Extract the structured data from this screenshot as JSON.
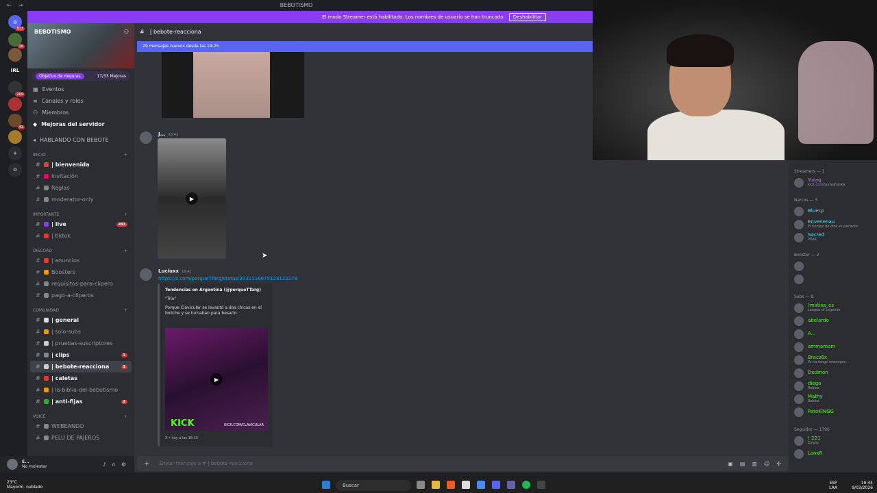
{
  "window": {
    "title": "BEBOTISMO",
    "nav_back": "←",
    "nav_fwd": "→"
  },
  "banner": {
    "text": "El modo Streamer está habilitado. Los nombres de usuario se han truncado.",
    "button": "Deshabilitar"
  },
  "server_rail": {
    "badges": [
      "813",
      "18",
      "209",
      "41"
    ],
    "irl_label": "IRL"
  },
  "sidebar": {
    "server_name": "BEBOTISMO",
    "boost": {
      "label": "Objetivo de mejoras",
      "count": "17/33 Mejoras"
    },
    "menu": [
      "Eventos",
      "Canales y roles",
      "Miembros",
      "Mejoras del servidor"
    ],
    "hablando": "HABLANDO CON BEBOTE",
    "categories": [
      {
        "name": "INICIO",
        "channels": [
          {
            "label": "| bienvenida",
            "bold": true,
            "badge": "",
            "color": "#c44"
          },
          {
            "label": "Invitación",
            "bold": false,
            "badge": "",
            "color": "#e06"
          },
          {
            "label": "Reglas",
            "bold": false,
            "badge": "",
            "color": "#888"
          },
          {
            "label": "moderator-only",
            "bold": false,
            "badge": "",
            "color": "#888"
          }
        ]
      },
      {
        "name": "IMPORTANTE",
        "channels": [
          {
            "label": "| live",
            "bold": true,
            "badge": "203",
            "color": "#8a3cf0"
          },
          {
            "label": "| tiktok",
            "bold": false,
            "badge": "",
            "color": "#e33"
          }
        ]
      },
      {
        "name": "DISCORD",
        "channels": [
          {
            "label": "| anuncios",
            "bold": false,
            "badge": "",
            "color": "#e33"
          },
          {
            "label": "Boosters",
            "bold": false,
            "badge": "",
            "color": "#e90"
          },
          {
            "label": "requisitos-para-clipero",
            "bold": false,
            "badge": "",
            "color": "#888"
          },
          {
            "label": "pago-a-cliperos",
            "bold": false,
            "badge": "",
            "color": "#888"
          }
        ]
      },
      {
        "name": "COMUNIDAD",
        "channels": [
          {
            "label": "| general",
            "bold": true,
            "badge": "",
            "color": "#ddd"
          },
          {
            "label": "| solo-subs",
            "bold": false,
            "badge": "",
            "color": "#e90"
          },
          {
            "label": "| pruebas-suscriptores",
            "bold": false,
            "badge": "",
            "color": "#ccc"
          },
          {
            "label": "| clips",
            "bold": true,
            "badge": "1",
            "color": "#888"
          },
          {
            "label": "| bebote-reacciona",
            "bold": true,
            "badge": "2",
            "color": "#ccc",
            "active": true
          },
          {
            "label": "| caletas",
            "bold": true,
            "badge": "",
            "color": "#e33"
          },
          {
            "label": "| la-biblia-del-bebotismo",
            "bold": false,
            "badge": "",
            "color": "#e90"
          },
          {
            "label": "| anti-fijas",
            "bold": true,
            "badge": "2",
            "color": "#3a3"
          }
        ]
      },
      {
        "name": "VOICE",
        "channels": [
          {
            "label": "WEBEANDO",
            "bold": false,
            "badge": "",
            "color": "#888"
          },
          {
            "label": "PELU DE PAJEROS",
            "bold": false,
            "badge": "",
            "color": "#888"
          }
        ]
      }
    ]
  },
  "user": {
    "name": "E...",
    "status": "No molestar"
  },
  "channel": {
    "name": "| bebote-reacciona",
    "new_messages": "29 mensajes nuevos desde las 19:25"
  },
  "messages": [
    {
      "author": "J...",
      "time": "19:41"
    },
    {
      "author": "Luciuxx",
      "time": "19:41",
      "link": "https://x.com/porqueTTarg/status/2031116675123122278",
      "embed": {
        "title": "Tendencias en Argentina (@porqueTTarg)",
        "quote": "\"Trío\"",
        "body": "Porque Clavicular se levantó a dos chicas en el boliche y se turnaban para besarlo.",
        "kick": "KICK",
        "kick_url": "KICK.COM/CLAVICULAR",
        "footer": "X • hoy a las 16:15"
      }
    }
  ],
  "composer": {
    "placeholder": "Enviar mensaje a #  | bebote-reacciona"
  },
  "members": {
    "groups": [
      {
        "title": "Streamers — 1",
        "items": [
          {
            "name": "Yuraq",
            "sub": "kick.com/yurasjhanka"
          }
        ]
      },
      {
        "title": "Narcos — 3",
        "items": [
          {
            "name": "BlueLp",
            "sub": ""
          },
          {
            "name": "Envenenau",
            "sub": "El tiempo de dios es perfecto"
          },
          {
            "name": "Sacred",
            "sub": "PEAK"
          }
        ]
      },
      {
        "title": "Booster — 2",
        "items": [
          {
            "name": "",
            "sub": ""
          },
          {
            "name": "",
            "sub": ""
          }
        ]
      },
      {
        "title": "Subs — 9",
        "items": [
          {
            "name": "!matias_es",
            "sub": "League of Legends"
          },
          {
            "name": "abelardo",
            "sub": ""
          },
          {
            "name": "A...",
            "sub": ""
          },
          {
            "name": "ammamam",
            "sub": ""
          },
          {
            "name": "Bracs6x",
            "sub": "Yo no tengo enemigos."
          },
          {
            "name": "Dedmon",
            "sub": ""
          },
          {
            "name": "diego",
            "sub": "Roblox"
          },
          {
            "name": "Mathy",
            "sub": "Roblox"
          },
          {
            "name": "PatoKINGG",
            "sub": ""
          }
        ]
      },
      {
        "title": "Seguidor — 1796",
        "items": [
          {
            "name": "! 221",
            "sub": "Empty"
          },
          {
            "name": "LonxR",
            "sub": ""
          }
        ]
      }
    ]
  },
  "taskbar": {
    "weather_temp": "23°C",
    "weather_desc": "Mayorm. nublado",
    "search": "Buscar",
    "lang1": "ESP",
    "lang2": "LAA",
    "time": "19:44",
    "date": "9/03/2026"
  }
}
